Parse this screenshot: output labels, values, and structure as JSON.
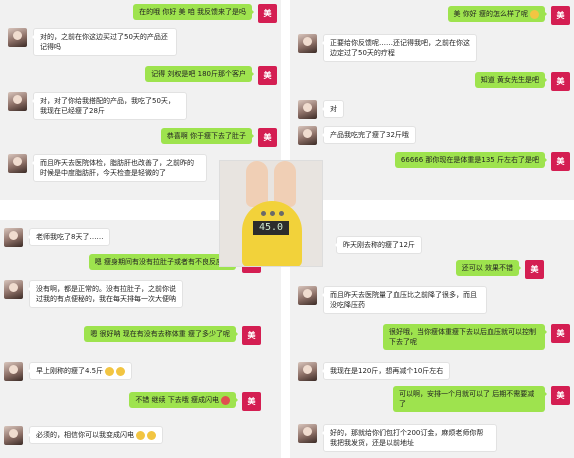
{
  "tl": {
    "m1": "在的哦 你好 美 咱 我反馈来了是吗",
    "m2": "对的，之前在你这边买过了50天的产品还记得吗",
    "m3": "记得 刘权是吧 180斤那个客户",
    "m4": "对，对了你给我搭配的产品，我吃了50天，我现在已经瘦了28斤",
    "m5": "恭喜啊 你于瘦下去了肚子",
    "m6": "而且昨天去医院体检，脂肪肝也改善了，之前昨的时候是中度脂肪肝，今天检查是轻微的了"
  },
  "tr": {
    "m1": "美 你好 瘦的怎么样了呢",
    "m2": "正要给你反馈呢……还记得我吧，之前在你这边定过了50天的疗程",
    "m3": "知道 黄女先生是吧",
    "m4": "对",
    "m5": "产品我吃完了瘦了32斤哦",
    "m6": "66666 那你现在是体重是135 斤左右了是吧"
  },
  "bl": {
    "m1": "老师我吃了8天了……",
    "m2": "嗯 瘦身期间有没有拉肚子或者有不良反应呢",
    "m3": "没有啊，都是正常的。没有拉肚子，之前你说过我的有点便秘的，我在每天排每一次大便呐",
    "m4": "嗯 很好呐  现在有没有去称体重 瘦了多少了呢",
    "m5": "早上刚称的瘦了4.5斤",
    "m6": "不错 继续 下去哦 瘦成闪电",
    "m7": "必须的，相信你可以我变成闪电"
  },
  "br": {
    "m1": "昨天刚去称的瘦了12斤",
    "m2": "还可以 效果不错",
    "m3": "而且昨天去医院量了血压比之前降了很多，而且没吃降压药",
    "m4": "很好哦，当你瘦体重瘦下去以后血压就可以控制下去了呢",
    "m5": "我现在是120斤，想再减个10斤左右",
    "m6": "可以啊，安排一个月就可以了 后期不需要减了",
    "m7": "好的，那就给你们包打个200订金，麻烦老师你帮我把我发货，还是以前地址"
  },
  "scale_reading": "45.0",
  "logo_text": "美",
  "colors": {
    "green": "#9ee34e",
    "logo": "#d41e52",
    "panel": "#f1f1f1"
  }
}
